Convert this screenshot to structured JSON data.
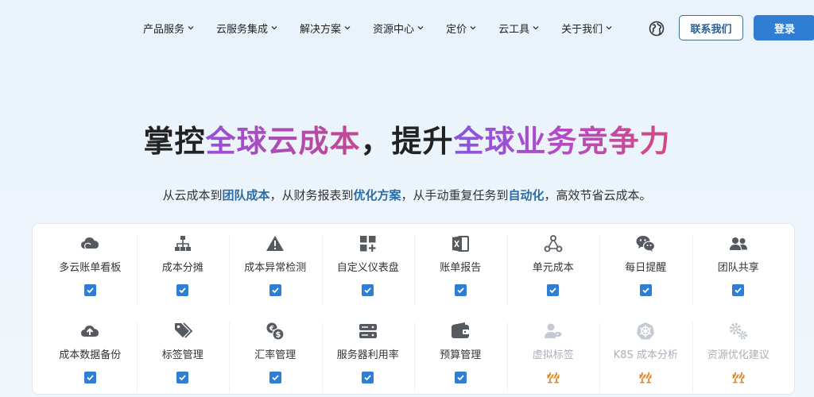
{
  "nav": {
    "items": [
      {
        "label": "产品服务"
      },
      {
        "label": "云服务集成"
      },
      {
        "label": "解决方案"
      },
      {
        "label": "资源中心"
      },
      {
        "label": "定价"
      },
      {
        "label": "云工具"
      },
      {
        "label": "关于我们"
      }
    ],
    "contact_label": "联系我们",
    "login_label": "登录"
  },
  "hero": {
    "title_1": "掌控",
    "title_2": "全球云成本",
    "title_3": "，提升",
    "title_4": "全球业务竞争力",
    "sub_1": "从云成本到",
    "sub_2": "团队成本",
    "sub_3": "，从财务报表到",
    "sub_4": "优化方案",
    "sub_5": "，从手动重复任务到",
    "sub_6": "自动化",
    "sub_7": "，高效节省云成本。"
  },
  "features": {
    "row1": [
      {
        "label": "多云账单看板",
        "icon": "cloud-icon",
        "status": "check"
      },
      {
        "label": "成本分摊",
        "icon": "hierarchy-icon",
        "status": "check"
      },
      {
        "label": "成本异常检测",
        "icon": "warning-icon",
        "status": "check"
      },
      {
        "label": "自定义仪表盘",
        "icon": "dashboard-add-icon",
        "status": "check"
      },
      {
        "label": "账单报告",
        "icon": "excel-icon",
        "status": "check"
      },
      {
        "label": "单元成本",
        "icon": "nodes-icon",
        "status": "check"
      },
      {
        "label": "每日提醒",
        "icon": "wechat-icon",
        "status": "check"
      },
      {
        "label": "团队共享",
        "icon": "team-icon",
        "status": "check"
      }
    ],
    "row2": [
      {
        "label": "成本数据备份",
        "icon": "cloud-upload-icon",
        "status": "check"
      },
      {
        "label": "标签管理",
        "icon": "tags-icon",
        "status": "check"
      },
      {
        "label": "汇率管理",
        "icon": "currency-exchange-icon",
        "status": "check"
      },
      {
        "label": "服务器利用率",
        "icon": "server-icon",
        "status": "check"
      },
      {
        "label": "预算管理",
        "icon": "wallet-icon",
        "status": "check"
      },
      {
        "label": "虚拟标签",
        "icon": "user-tag-icon",
        "status": "construction"
      },
      {
        "label": "K8S 成本分析",
        "icon": "kubernetes-icon",
        "status": "construction"
      },
      {
        "label": "资源优化建议",
        "icon": "gears-icon",
        "status": "construction"
      }
    ]
  },
  "colors": {
    "primary": "#2f7ed3",
    "icon_gray": "#555a60",
    "icon_dim": "#c3cad2",
    "construction": "#e08a2a"
  }
}
